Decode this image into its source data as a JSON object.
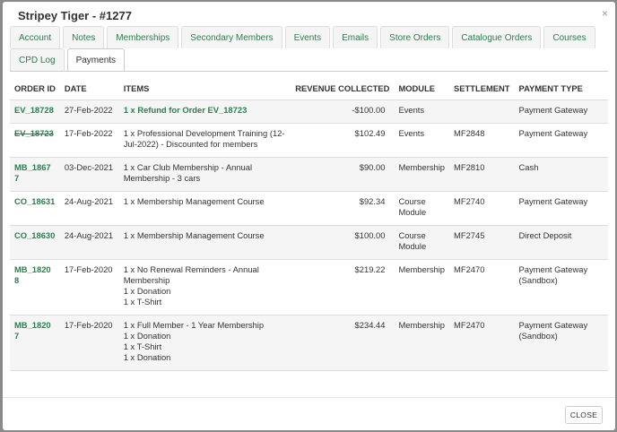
{
  "modal": {
    "title": "Stripey Tiger - #1277",
    "close_icon": "×"
  },
  "tabs_row1": [
    "Account",
    "Notes",
    "Memberships",
    "Secondary Members",
    "Events",
    "Emails",
    "Store Orders",
    "Catalogue Orders",
    "Courses"
  ],
  "tabs_row2": [
    "CPD Log",
    "Payments"
  ],
  "active_tab": "Payments",
  "table": {
    "headers": [
      "ORDER ID",
      "DATE",
      "ITEMS",
      "REVENUE COLLECTED",
      "MODULE",
      "SETTLEMENT",
      "PAYMENT TYPE"
    ],
    "rows": [
      {
        "order_id": "EV_18728",
        "date": "27-Feb-2022",
        "items": [
          "1 x Refund for Order EV_18723"
        ],
        "revenue": "-$100.00",
        "module": "Events",
        "settlement": "",
        "payment_type": "Payment Gateway"
      },
      {
        "order_id": "EV_18723",
        "date": "17-Feb-2022",
        "items": [
          "1 x Professional Development Training (12-Jul-2022) - Discounted for members"
        ],
        "revenue": "$102.49",
        "module": "Events",
        "settlement": "MF2848",
        "payment_type": "Payment Gateway"
      },
      {
        "order_id": "MB_18677",
        "date": "03-Dec-2021",
        "items": [
          "1 x Car Club Membership - Annual Membership - 3 cars"
        ],
        "revenue": "$90.00",
        "module": "Membership",
        "settlement": "MF2810",
        "payment_type": "Cash"
      },
      {
        "order_id": "CO_18631",
        "date": "24-Aug-2021",
        "items": [
          "1 x Membership Management Course"
        ],
        "revenue": "$92.34",
        "module": "Course Module",
        "settlement": "MF2740",
        "payment_type": "Payment Gateway"
      },
      {
        "order_id": "CO_18630",
        "date": "24-Aug-2021",
        "items": [
          "1 x Membership Management Course"
        ],
        "revenue": "$100.00",
        "module": "Course Module",
        "settlement": "MF2745",
        "payment_type": "Direct Deposit"
      },
      {
        "order_id": "MB_18208",
        "date": "17-Feb-2020",
        "items": [
          "1 x No Renewal Reminders - Annual Membership",
          "1 x Donation",
          "1 x T-Shirt"
        ],
        "revenue": "$219.22",
        "module": "Membership",
        "settlement": "MF2470",
        "payment_type": "Payment Gateway (Sandbox)"
      },
      {
        "order_id": "MB_18207",
        "date": "17-Feb-2020",
        "items": [
          "1 x Full Member - 1 Year Membership",
          "1 x Donation",
          "1 x T-Shirt",
          "1 x Donation"
        ],
        "revenue": "$234.44",
        "module": "Membership",
        "settlement": "MF2470",
        "payment_type": "Payment Gateway (Sandbox)"
      }
    ]
  },
  "footer": {
    "close_label": "CLOSE"
  }
}
